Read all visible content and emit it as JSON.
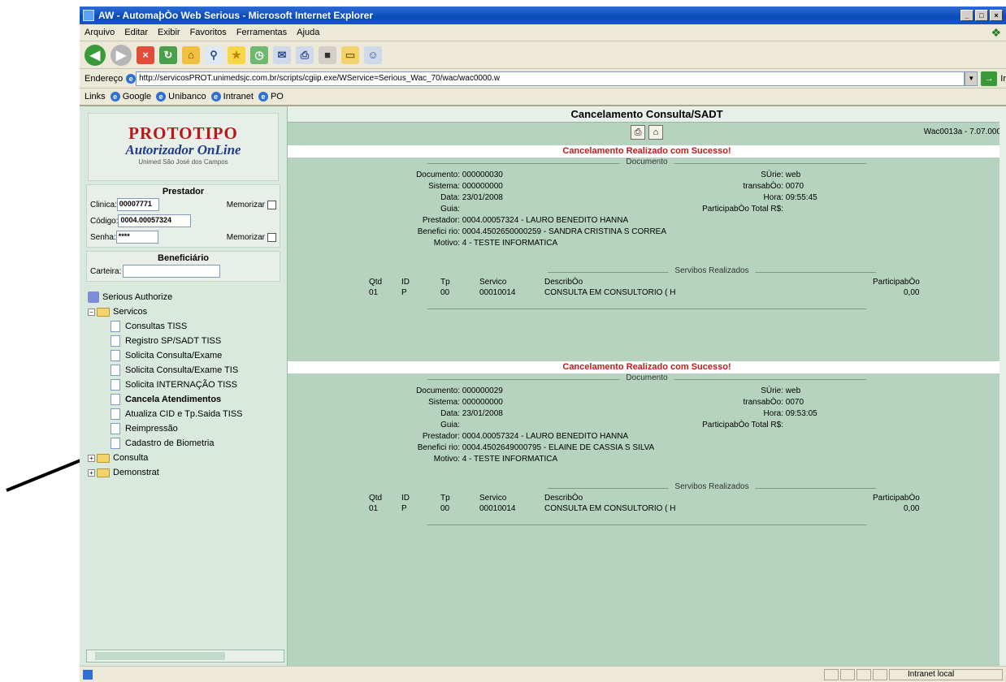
{
  "window": {
    "title": "AW - AutomaþÒo Web Serious - Microsoft Internet Explorer"
  },
  "menu": [
    "Arquivo",
    "Editar",
    "Exibir",
    "Favoritos",
    "Ferramentas",
    "Ajuda"
  ],
  "address": {
    "label": "Endereço",
    "url": "http://servicosPROT.unimedsjc.com.br/scripts/cgiip.exe/WService=Serious_Wac_70/wac/wac0000.w",
    "go": "Ir"
  },
  "links": {
    "label": "Links",
    "items": [
      "Google",
      "Unibanco",
      "Intranet",
      "PO"
    ]
  },
  "sidebar": {
    "logo": {
      "line1": "PROTOTIPO",
      "line2": "Autorizador OnLine",
      "line3": "Unimed São José dos Campos"
    },
    "prestador": {
      "heading": "Prestador",
      "clinica_label": "Clinica:",
      "clinica_value": "00007771",
      "memorizar_label": "Memorizar",
      "codigo_label": "Código:",
      "codigo_value": "0004.00057324",
      "senha_label": "Senha:",
      "senha_value": "****"
    },
    "beneficiario": {
      "heading": "Beneficiário",
      "carteira_label": "Carteira:"
    },
    "tree": {
      "root": "Serious Authorize",
      "servicos": "Servicos",
      "items": [
        "Consultas TISS",
        "Registro SP/SADT TISS",
        "Solicita Consulta/Exame",
        "Solicita Consulta/Exame TIS",
        "Solicita INTERNAÇÃO TISS",
        "Cancela Atendimentos",
        "Atualiza CID e Tp.Saida TISS",
        "Reimpressão",
        "Cadastro de Biometria"
      ],
      "consulta": "Consulta",
      "demonstrat": "Demonstrat"
    }
  },
  "main": {
    "title": "Cancelamento Consulta/SADT",
    "version": "Wac0013a - 7.07.000",
    "section_document": "Documento",
    "section_services": "Servibos Realizados",
    "labels": {
      "documento": "Documento:",
      "sistema": "Sistema:",
      "data": "Data:",
      "guia": "Guia:",
      "prestador": "Prestador:",
      "beneficiario": "Benefici rio:",
      "motivo": "Motivo:",
      "serie": "SÚrie:",
      "transacao": "transabÒo:",
      "hora": "Hora:",
      "participacao_total": "ParticipabÒo Total R$:"
    },
    "table_headers": {
      "qtd": "Qtd",
      "id": "ID",
      "tp": "Tp",
      "servico": "Servico",
      "descricao": "DescribÒo",
      "participacao": "ParticipabÒo"
    },
    "records": [
      {
        "banner": "Cancelamento Realizado com Sucesso!",
        "documento": "000000030",
        "sistema": "000000000",
        "data": "23/01/2008",
        "guia": "",
        "prestador": "0004.00057324 - LAURO BENEDITO HANNA",
        "beneficiario": "0004.4502650000259 - SANDRA CRISTINA S CORREA",
        "motivo": "4 - TESTE INFORMATICA",
        "serie": "web",
        "transacao": "0070",
        "hora": "09:55:45",
        "participacao_total": "",
        "row": {
          "qtd": "01",
          "id": "P",
          "tp": "00",
          "servico": "00010014",
          "descricao": "CONSULTA EM CONSULTORIO ( H",
          "participacao": "0,00"
        }
      },
      {
        "banner": "Cancelamento Realizado com Sucesso!",
        "documento": "000000029",
        "sistema": "000000000",
        "data": "23/01/2008",
        "guia": "",
        "prestador": "0004.00057324 - LAURO BENEDITO HANNA",
        "beneficiario": "0004.4502649000795 - ELAINE DE CASSIA S SILVA",
        "motivo": "4 - TESTE INFORMATICA",
        "serie": "web",
        "transacao": "0070",
        "hora": "09:53:05",
        "participacao_total": "",
        "row": {
          "qtd": "01",
          "id": "P",
          "tp": "00",
          "servico": "00010014",
          "descricao": "CONSULTA EM CONSULTORIO ( H",
          "participacao": "0,00"
        }
      }
    ]
  },
  "status": {
    "zone": "Intranet local"
  },
  "colors": {
    "panel_green": "#b5d3bf",
    "banner_red": "#c01c1c",
    "titlebar_blue": "#0a4ab8"
  }
}
